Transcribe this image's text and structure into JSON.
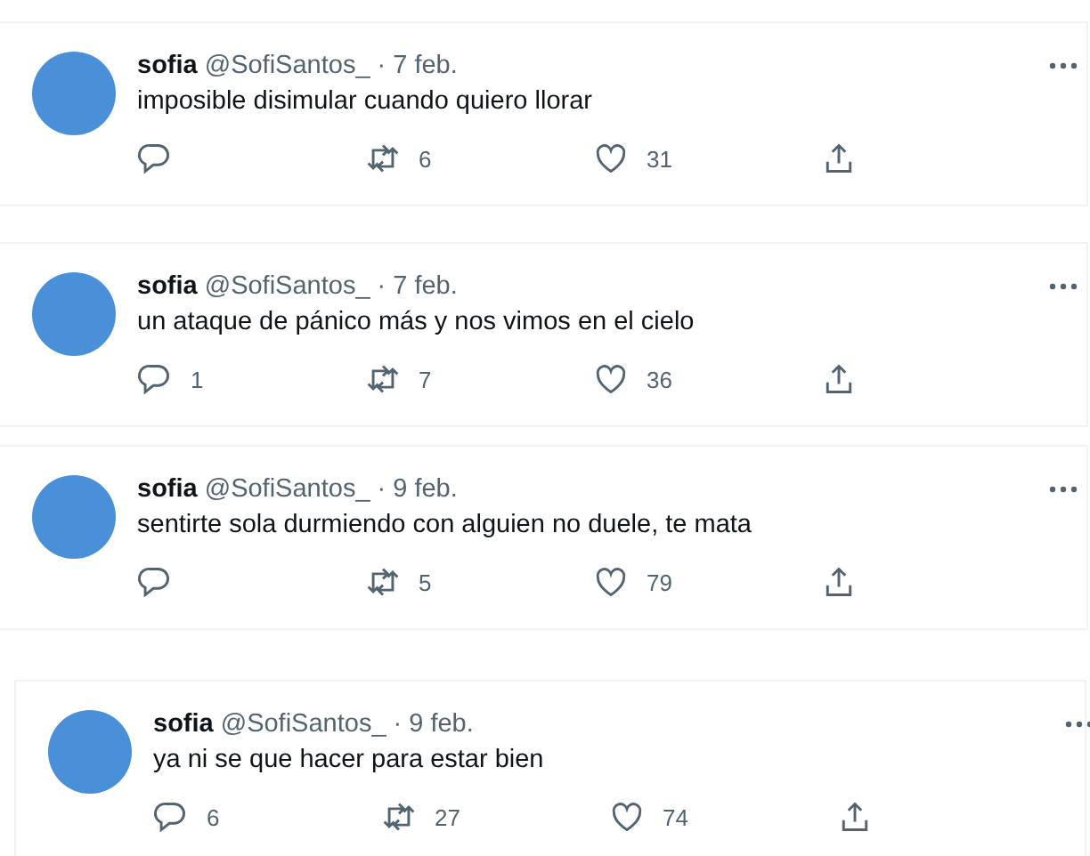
{
  "tweets": [
    {
      "name": "sofia",
      "handle": "@SofiSantos_",
      "date": "· 7 feb.",
      "text": "imposible disimular cuando quiero llorar",
      "retweets": "6",
      "likes": "31"
    },
    {
      "name": "sofia",
      "handle": "@SofiSantos_",
      "date": "· 7 feb.",
      "text": "un ataque de pánico más y nos vimos en el cielo",
      "replies": "1",
      "retweets": "7",
      "likes": "36"
    },
    {
      "name": "sofia",
      "handle": "@SofiSantos_",
      "date": "· 9 feb.",
      "text": "sentirte sola durmiendo con alguien no duele, te mata",
      "retweets": "5",
      "likes": "79"
    },
    {
      "name": "sofia",
      "handle": "@SofiSantos_",
      "date": "· 9 feb.",
      "text": "ya ni se que hacer para estar bien",
      "replies": "6",
      "retweets": "27",
      "likes": "74"
    }
  ]
}
